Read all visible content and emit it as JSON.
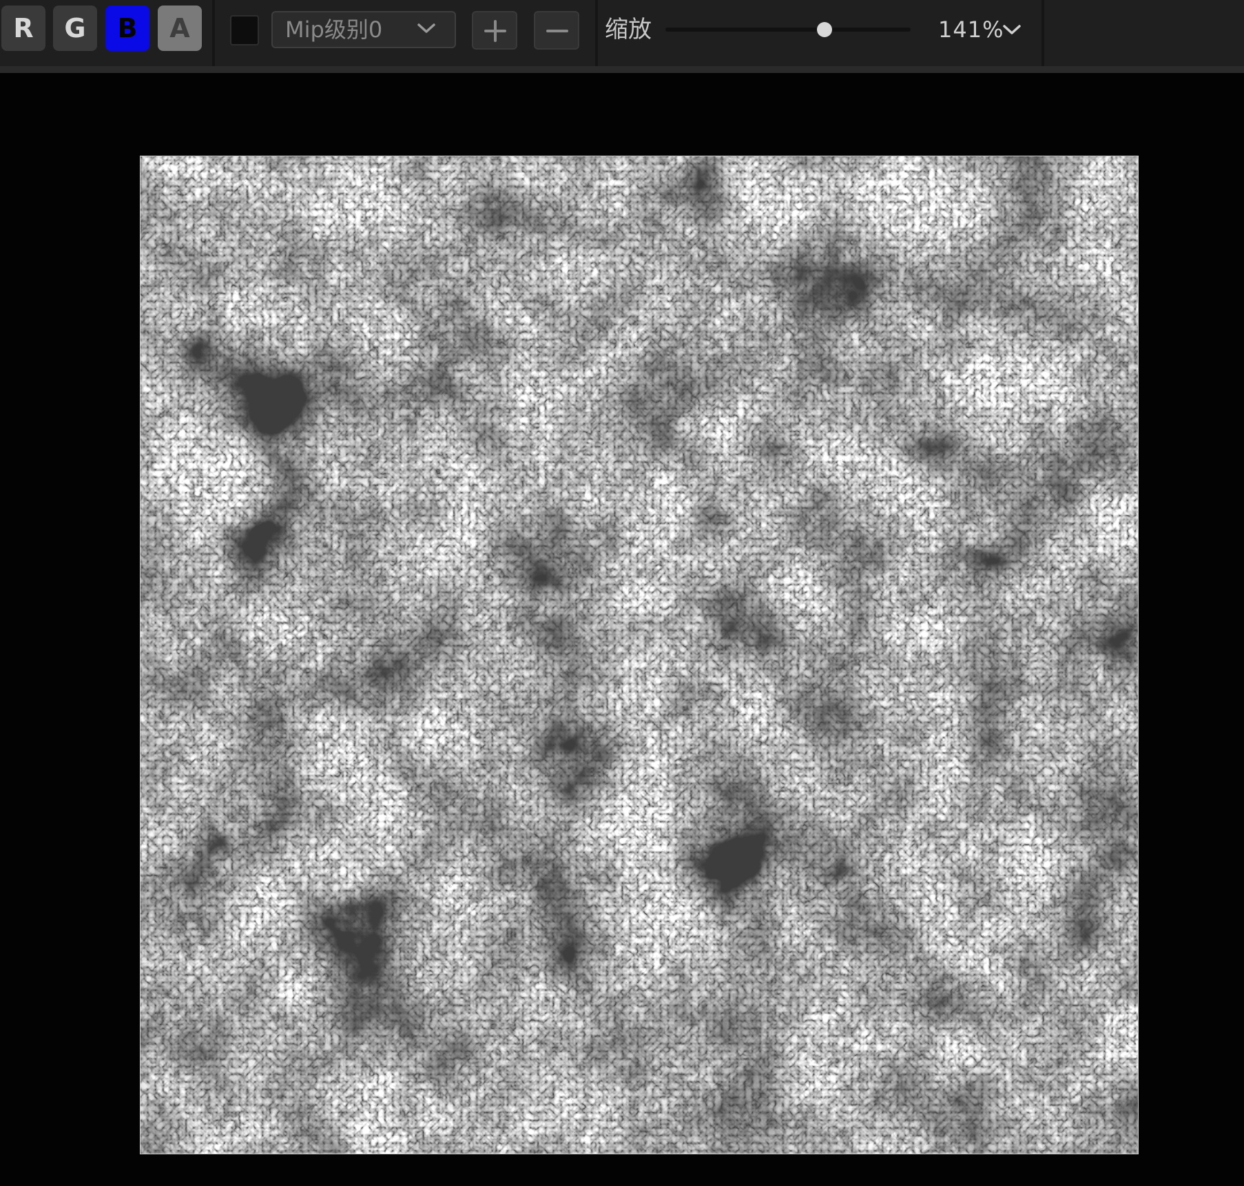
{
  "toolbar": {
    "channels": [
      {
        "label": "R",
        "state": "on"
      },
      {
        "label": "G",
        "state": "on"
      },
      {
        "label": "B",
        "state": "active"
      },
      {
        "label": "A",
        "state": "on"
      }
    ],
    "background_swatch_color": "#0d0d0d",
    "mip_select": {
      "value": "Mip级别0",
      "icon": "chevron-down-icon"
    },
    "zoom_in_icon": "plus-icon",
    "zoom_out_icon": "minus-icon",
    "zoom": {
      "label": "缩放",
      "slider_fraction": 0.65,
      "value": "141%",
      "icon": "chevron-down-icon"
    }
  },
  "colors": {
    "toolbar_bg": "#1f1f1f",
    "viewport_bg": "#030303",
    "blue_channel_active": "#0a0ae6"
  },
  "viewport": {
    "content": "grayscale noise texture (cellular/cloud pattern)"
  }
}
